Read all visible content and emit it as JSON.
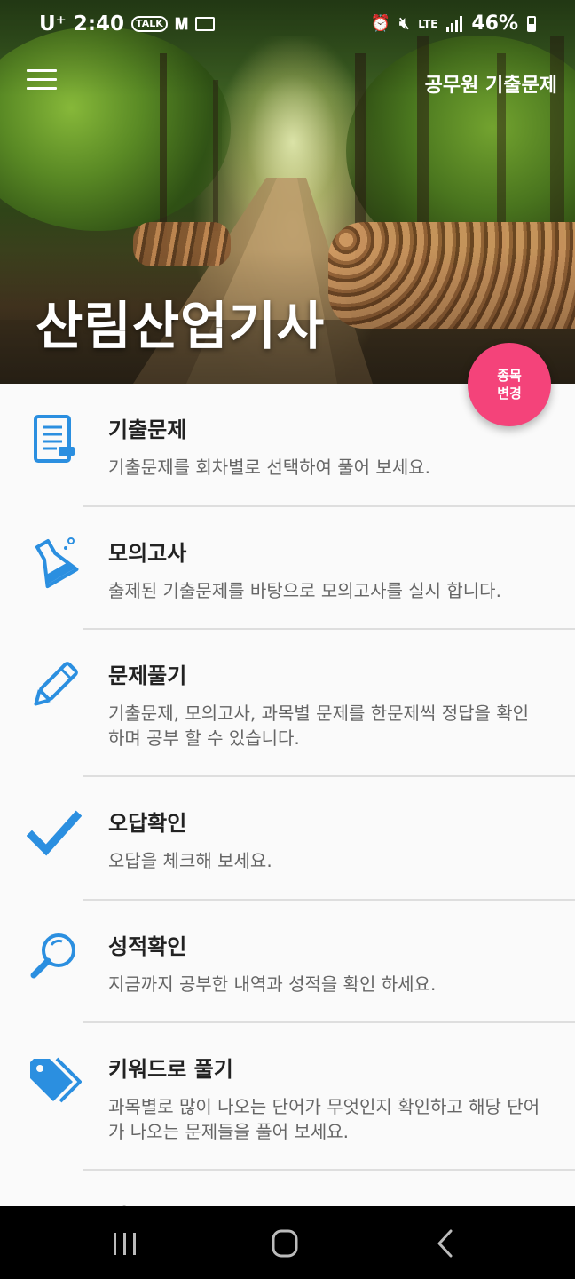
{
  "status_bar": {
    "carrier": "U⁺",
    "time": "2:40",
    "talk_badge": "TALK",
    "lte": "LTE",
    "battery": "46%"
  },
  "toolbar": {
    "menu_icon": "hamburger-menu-icon",
    "app_title": "공무원 기출문제"
  },
  "hero": {
    "title": "산림산업기사"
  },
  "fab": {
    "line1": "종목",
    "line2": "변경"
  },
  "menu_items": [
    {
      "icon": "document-list-icon",
      "title": "기출문제",
      "desc": "기출문제를 회차별로 선택하여 풀어 보세요."
    },
    {
      "icon": "flask-icon",
      "title": "모의고사",
      "desc": "출제된 기출문제를 바탕으로 모의고사를 실시 합니다."
    },
    {
      "icon": "pencil-icon",
      "title": "문제풀기",
      "desc": "기출문제, 모의고사, 과목별 문제를 한문제씩 정답을 확인하며 공부 할 수 있습니다."
    },
    {
      "icon": "checkmark-icon",
      "title": "오답확인",
      "desc": "오답을 체크해 보세요."
    },
    {
      "icon": "magnifier-icon",
      "title": "성적확인",
      "desc": "지금까지 공부한 내역과 성적을 확인 하세요."
    },
    {
      "icon": "tag-icon",
      "title": "키워드로 풀기",
      "desc": "과목별로 많이 나오는 단어가 무엇인지 확인하고 해당 단어가 나오는 문제들을 풀어 보세요."
    },
    {
      "icon": "info-icon",
      "title": "정보공유",
      "desc": ""
    }
  ],
  "accent_color": "#2b8fe0",
  "fab_color": "#f4437a",
  "navbar": {
    "recents_icon": "recents-icon",
    "home_icon": "home-icon",
    "back_icon": "back-icon"
  }
}
